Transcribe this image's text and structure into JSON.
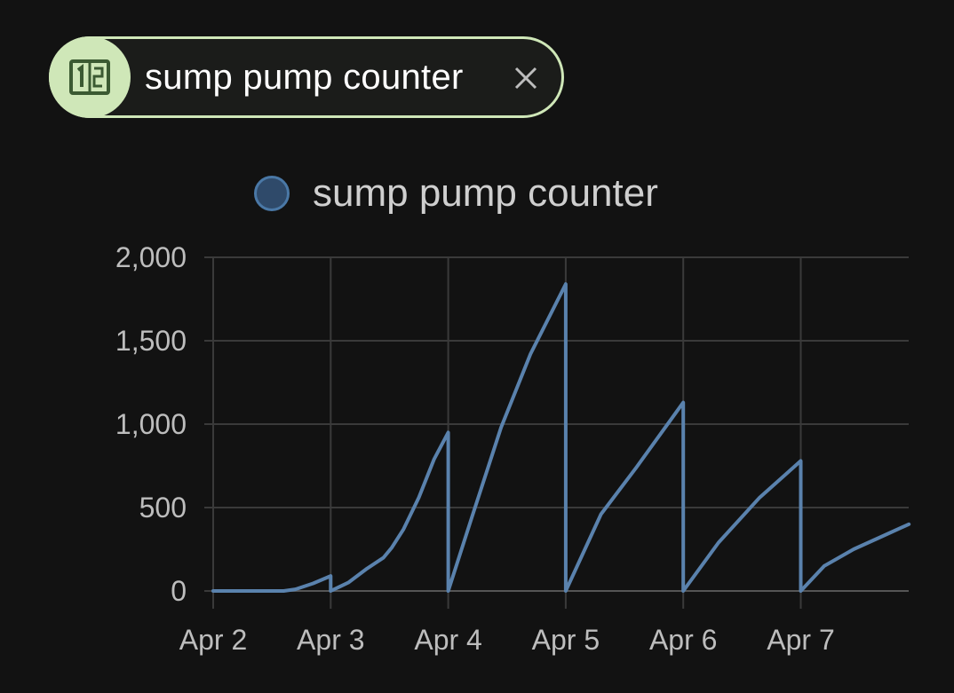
{
  "chip": {
    "label": "sump pump counter",
    "icon": "counter-icon",
    "close_icon": "close-icon"
  },
  "colors": {
    "chip_accent": "#cfe7b8",
    "series_line": "#5a82ad",
    "series_fill": "#2f4a6a",
    "background": "#121212",
    "grid": "#3a3a3a"
  },
  "chart_data": {
    "type": "line",
    "legend": "top",
    "grid": true,
    "xlim": [
      0,
      5.92
    ],
    "ylim": [
      0,
      2000
    ],
    "x_tick_values": [
      0,
      1,
      2,
      3,
      4,
      5
    ],
    "x_tick_labels": [
      "Apr 2",
      "Apr 3",
      "Apr 4",
      "Apr 5",
      "Apr 6",
      "Apr 7"
    ],
    "y_ticks": [
      0,
      500,
      1000,
      1500,
      2000
    ],
    "y_tick_labels": [
      "0",
      "500",
      "1,000",
      "1,500",
      "2,000"
    ],
    "series": [
      {
        "name": "sump pump counter",
        "points": [
          [
            0,
            0
          ],
          [
            0.3,
            0
          ],
          [
            0.6,
            0
          ],
          [
            0.7,
            10
          ],
          [
            0.85,
            45
          ],
          [
            1.0,
            90
          ],
          [
            1.0,
            0
          ],
          [
            1.15,
            50
          ],
          [
            1.3,
            130
          ],
          [
            1.45,
            200
          ],
          [
            1.52,
            260
          ],
          [
            1.62,
            370
          ],
          [
            1.75,
            560
          ],
          [
            1.88,
            790
          ],
          [
            2.0,
            950
          ],
          [
            2.0,
            0
          ],
          [
            2.2,
            440
          ],
          [
            2.45,
            980
          ],
          [
            2.7,
            1420
          ],
          [
            3.0,
            1840
          ],
          [
            3.0,
            0
          ],
          [
            3.3,
            460
          ],
          [
            3.6,
            740
          ],
          [
            4.0,
            1130
          ],
          [
            4.0,
            0
          ],
          [
            4.3,
            290
          ],
          [
            4.65,
            560
          ],
          [
            5.0,
            780
          ],
          [
            5.0,
            0
          ],
          [
            5.2,
            150
          ],
          [
            5.45,
            250
          ],
          [
            5.7,
            330
          ],
          [
            5.92,
            400
          ]
        ]
      }
    ]
  }
}
